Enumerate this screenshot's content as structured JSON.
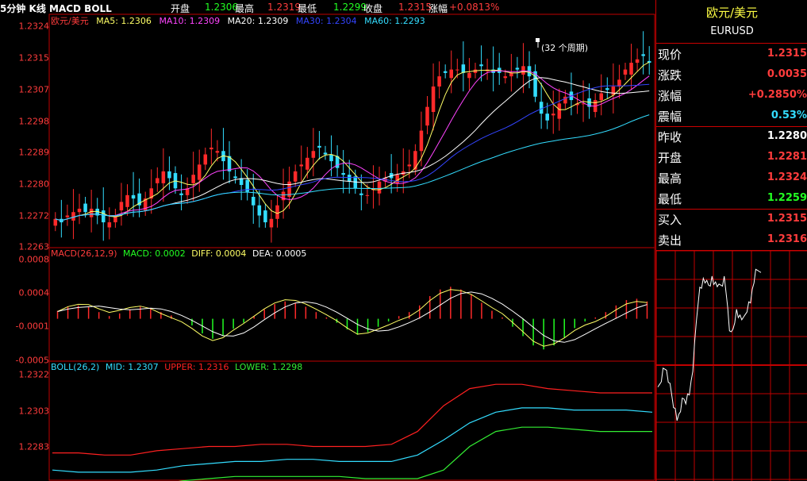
{
  "header": {
    "title": "5分钟 K线 MACD BOLL",
    "open_label": "开盘",
    "open_value": "1.2306",
    "high_label": "最高",
    "high_value": "1.2319",
    "low_label": "最低",
    "low_value": "1.2299",
    "close_label": "收盘",
    "close_value": "1.2315",
    "change_label": "涨幅",
    "change_value": "+0.0813%"
  },
  "main_panel": {
    "symbol": "欧元/美元",
    "ma": [
      {
        "label": "MA5: 1.2306",
        "color": "#ffff66"
      },
      {
        "label": "MA10: 1.2309",
        "color": "#ff44ff"
      },
      {
        "label": "MA20: 1.2309",
        "color": "#ffffff"
      },
      {
        "label": "MA30: 1.2304",
        "color": "#3344ff"
      },
      {
        "label": "MA60: 1.2293",
        "color": "#33ddff"
      }
    ],
    "annotation": "(32 个周期)",
    "yticks": [
      "1.2324",
      "1.2315",
      "1.2307",
      "1.2298",
      "1.2289",
      "1.2280",
      "1.2272",
      "1.2263"
    ]
  },
  "macd_panel": {
    "name": "MACD(26,12,9)",
    "macd": "MACD: 0.0002",
    "diff": "DIFF: 0.0004",
    "dea": "DEA: 0.0005",
    "yticks": [
      "0.0008",
      "0.0004",
      "-0.0001",
      "-0.0005"
    ]
  },
  "boll_panel": {
    "name": "BOLL(26,2)",
    "mid": "MID: 1.2307",
    "upper": "UPPER: 1.2316",
    "lower": "LOWER: 1.2298",
    "yticks": [
      "1.2322",
      "1.2303",
      "1.2283"
    ]
  },
  "sidebar": {
    "title": "欧元/美元",
    "symbol_code": "EURUSD",
    "rows": [
      {
        "label": "现价",
        "value": "1.2315",
        "color": "#ff3c3c"
      },
      {
        "label": "涨跌",
        "value": "0.0035",
        "color": "#ff3c3c"
      },
      {
        "label": "涨幅",
        "value": "+0.2850%",
        "color": "#ff3c3c"
      },
      {
        "label": "震幅",
        "value": "0.53%",
        "color": "#33ddff"
      },
      {
        "label": "昨收",
        "value": "1.2280",
        "color": "#ffffff"
      },
      {
        "label": "开盘",
        "value": "1.2281",
        "color": "#ff3c3c"
      },
      {
        "label": "最高",
        "value": "1.2324",
        "color": "#ff3c3c"
      },
      {
        "label": "最低",
        "value": "1.2259",
        "color": "#22ff22"
      },
      {
        "label": "买入",
        "value": "1.2315",
        "color": "#ff3c3c"
      },
      {
        "label": "卖出",
        "value": "1.2316",
        "color": "#ff3c3c"
      }
    ]
  },
  "chart_data": [
    {
      "type": "candlestick",
      "title": "欧元/美元",
      "ylim": [
        1.2261,
        1.2326
      ],
      "close_series": [
        1.2269,
        1.2268,
        1.227,
        1.2271,
        1.2272,
        1.2271,
        1.2272,
        1.227,
        1.2268,
        1.2268,
        1.227,
        1.2274,
        1.2276,
        1.2275,
        1.2273,
        1.2275,
        1.2278,
        1.2281,
        1.2283,
        1.2281,
        1.2278,
        1.2276,
        1.2278,
        1.2282,
        1.2285,
        1.2288,
        1.229,
        1.2289,
        1.2286,
        1.2283,
        1.2281,
        1.2279,
        1.2277,
        1.2273,
        1.227,
        1.2268,
        1.2269,
        1.2273,
        1.2277,
        1.228,
        1.2283,
        1.2285,
        1.2287,
        1.2289,
        1.229,
        1.2288,
        1.2286,
        1.2284,
        1.2282,
        1.228,
        1.2278,
        1.2276,
        1.2276,
        1.2278,
        1.228,
        1.2281,
        1.2281,
        1.2282,
        1.2283,
        1.2285,
        1.2289,
        1.2295,
        1.2302,
        1.2308,
        1.2311,
        1.2312,
        1.2313,
        1.2313,
        1.2312,
        1.2312,
        1.2313,
        1.2314,
        1.2313,
        1.2312,
        1.2312,
        1.2311,
        1.2312,
        1.2313,
        1.2314,
        1.2311,
        1.2305,
        1.23,
        1.2298,
        1.23,
        1.2303,
        1.2305,
        1.2304,
        1.2303,
        1.2303,
        1.2302,
        1.2304,
        1.2306,
        1.2307,
        1.2308,
        1.231,
        1.2313,
        1.2315,
        1.2316,
        1.2317,
        1.2315
      ]
    },
    {
      "type": "bar",
      "title": "MACD(26,12,9)",
      "ylim": [
        -0.0006,
        0.0009
      ],
      "macd_series": [
        0.00012,
        0.00018,
        0.0002,
        0.00018,
        0.0001,
        4e-05,
        8e-05,
        0.00014,
        0.00018,
        0.00016,
        0.0001,
        5e-05,
        0.0,
        -0.0001,
        -0.00022,
        -0.0003,
        -0.00026,
        -0.00015,
        -6e-05,
        4e-05,
        0.00014,
        0.00022,
        0.00026,
        0.00024,
        0.00018,
        0.0001,
        2e-05,
        -6e-05,
        -0.00016,
        -0.00024,
        -0.0002,
        -0.00012,
        -4e-05,
        4e-05,
        0.0001,
        0.0002,
        0.00034,
        0.00044,
        0.00048,
        0.00044,
        0.00036,
        0.00024,
        0.00012,
        2e-05,
        -0.00012,
        -0.00026,
        -0.0004,
        -0.00046,
        -0.0004,
        -0.00028,
        -0.00014,
        -4e-05,
        2e-05,
        0.0001,
        0.0002,
        0.00028,
        0.0003,
        0.00026
      ]
    },
    {
      "type": "line",
      "title": "BOLL(26,2)",
      "ylim": [
        1.2276,
        1.2326
      ],
      "series": [
        {
          "name": "UPPER",
          "color": "#ff2020",
          "values": [
            1.2288,
            1.2288,
            1.2287,
            1.2287,
            1.2289,
            1.229,
            1.2291,
            1.2291,
            1.2292,
            1.2292,
            1.2291,
            1.2291,
            1.2291,
            1.2292,
            1.2298,
            1.231,
            1.2318,
            1.232,
            1.232,
            1.2318,
            1.2317,
            1.2316,
            1.2316,
            1.2316
          ]
        },
        {
          "name": "MID",
          "color": "#33ddff",
          "values": [
            1.228,
            1.2279,
            1.2279,
            1.2279,
            1.228,
            1.2282,
            1.2283,
            1.2284,
            1.2284,
            1.2285,
            1.2285,
            1.2284,
            1.2284,
            1.2284,
            1.2287,
            1.2294,
            1.2302,
            1.2307,
            1.2309,
            1.2309,
            1.2308,
            1.2308,
            1.2308,
            1.2307
          ]
        },
        {
          "name": "LOWER",
          "color": "#33ee33",
          "values": [
            1.2272,
            1.2271,
            1.2271,
            1.2272,
            1.2273,
            1.2275,
            1.2276,
            1.2277,
            1.2277,
            1.2277,
            1.2277,
            1.2277,
            1.2276,
            1.2276,
            1.2276,
            1.228,
            1.2291,
            1.2298,
            1.23,
            1.23,
            1.2299,
            1.2298,
            1.2298,
            1.2298
          ]
        }
      ]
    }
  ]
}
